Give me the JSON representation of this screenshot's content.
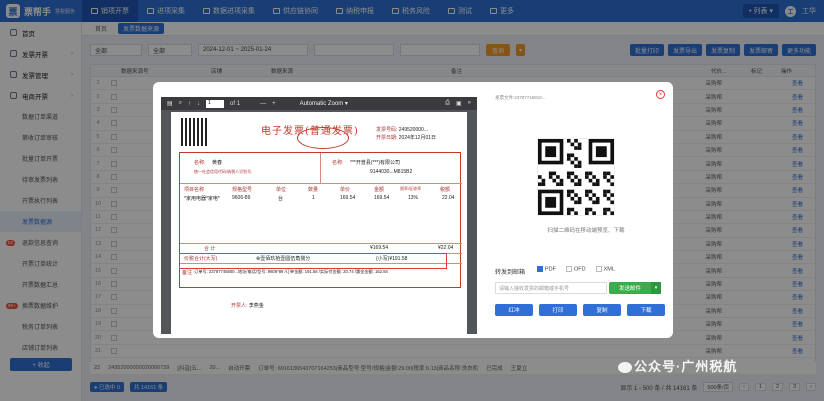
{
  "topbar": {
    "brand": "票帮手",
    "brand_sub": "慧税服务",
    "items": [
      "销项开票",
      "进项采集",
      "数据进项采集",
      "供应链协同",
      "纳税申报",
      "税务风险",
      "测试",
      "更多"
    ],
    "company": "• 列表 ▾",
    "user": "工华"
  },
  "sidebar": {
    "items": [
      {
        "label": "首页",
        "type": "group"
      },
      {
        "label": "发票开票",
        "type": "group"
      },
      {
        "label": "发票管理",
        "type": "group"
      },
      {
        "label": "电商开票",
        "type": "group"
      },
      {
        "label": "数据订单渠道",
        "type": "sub"
      },
      {
        "label": "第收订单审核",
        "type": "sub"
      },
      {
        "label": "批量订单开票",
        "type": "sub"
      },
      {
        "label": "待审发票列表",
        "type": "sub"
      },
      {
        "label": "开票执行列表",
        "type": "sub"
      },
      {
        "label": "发票数据源",
        "type": "sub",
        "active": true
      },
      {
        "label": "退款信息查询",
        "type": "sub",
        "badge": "52"
      },
      {
        "label": "开票订单统计",
        "type": "sub"
      },
      {
        "label": "开票数据汇总",
        "type": "sub"
      },
      {
        "label": "换票数据维护",
        "type": "sub",
        "badge": "99+"
      },
      {
        "label": "税务订单列表",
        "type": "sub"
      },
      {
        "label": "店铺订单列表",
        "type": "sub"
      }
    ],
    "collapse": "+ 收起"
  },
  "tabs": [
    "首页",
    "发票数据来源"
  ],
  "filters": {
    "sel1": "全部",
    "sel2": "全部",
    "date_from": "2024-12-01",
    "date_sep": "~",
    "date_to": "2025-01-24",
    "query": "查询",
    "more": "▾"
  },
  "right_buttons": [
    "批量打印",
    "发票导出",
    "发票复制",
    "发票邮寄",
    "更多功能"
  ],
  "grid": {
    "headers": [
      "数据来源号",
      "店铺",
      "数据来源",
      "备注",
      "",
      "代价...",
      "标记",
      "操作"
    ],
    "ops_label": "查看",
    "row_source": "采购帮",
    "row_numbers": [
      "1",
      "2",
      "3",
      "4",
      "5",
      "6",
      "7",
      "8",
      "9",
      "10",
      "11",
      "12",
      "13",
      "14",
      "15",
      "16",
      "17",
      "18",
      "19",
      "20",
      "21"
    ],
    "last_row": {
      "num": "22",
      "id": "24952000000020066739",
      "shop": "[抖音]五...",
      "ref": "20...",
      "source": "自动开票",
      "remark": "订单号: 6916136543707164253|商品型号:型号/规格|金额:29.00|税率:0.13|商品名称:洗衣机",
      "status": "已完成",
      "person": "王夏立"
    }
  },
  "footer": {
    "selected": "● 已选中 0",
    "total_chip": "共 14161 条",
    "page_info": "显示 1 - 500 条 / 共 14161 条",
    "page_size": "500条/页",
    "pages": [
      "‹",
      "1",
      "2",
      "3",
      "›"
    ]
  },
  "modal": {
    "pdf": {
      "page": "1",
      "of": "of 1",
      "zoom": "Automatic Zoom ▾",
      "minus": "—",
      "plus": "+"
    },
    "invoice": {
      "title": "电子发票(普通发票)",
      "meta_no_label": "发票号码:",
      "meta_no": "249520000...",
      "meta_date_label": "开票日期:",
      "meta_date": "2024年12月01日",
      "buyer_name_label": "名称:",
      "buyer_name": "黄春",
      "buyer_tax_label": "统一社会信用代码/纳税人识别号:",
      "seller_label": "名称:",
      "seller_name": "***开普县(***)有限公司",
      "seller_tax": "9144030...M815B2",
      "col_headers": [
        "项目名称",
        "规格型号",
        "单位",
        "数量",
        "单价",
        "金额",
        "税率/征收率",
        "税额"
      ],
      "item": "*家用电器*家电*",
      "spec": "9606-89",
      "unit": "台",
      "qty": "1",
      "price": "169.54",
      "amount": "169.54",
      "rate": "13%",
      "tax": "22.04",
      "total_label": "合  计",
      "total_amount": "¥169.54",
      "total_tax": "¥22.04",
      "price_tax_label": "价税合计(大写)",
      "price_tax_words": "⊗壹佰玖拾壹圆伍角捌分",
      "price_tax_small": "(小写)¥191.58",
      "remark_label": "备注",
      "remark": "订单号: 23787746800...地址/电话/型号: 9606*89 /订单金额: 191.58 /实际付金额: 20.74 /惠金金额: 162.84",
      "payee_label": "开票人:",
      "payee": "李燕金"
    },
    "side": {
      "url": "发票文件:23787746810...",
      "qr_caption": "扫描二维码在移动端预览、下载",
      "forward_label": "转发到邮箱",
      "formats": [
        {
          "label": "PDF",
          "on": true
        },
        {
          "label": "OFD",
          "on": false
        },
        {
          "label": "XML",
          "on": false
        }
      ],
      "email_placeholder": "请输入接收发票的邮箱或手机号",
      "send": "发送邮件",
      "send_dd": "▾",
      "actions": [
        "红冲",
        "打印",
        "复制",
        "下载"
      ]
    }
  },
  "watermark": "公众号·广州税航"
}
